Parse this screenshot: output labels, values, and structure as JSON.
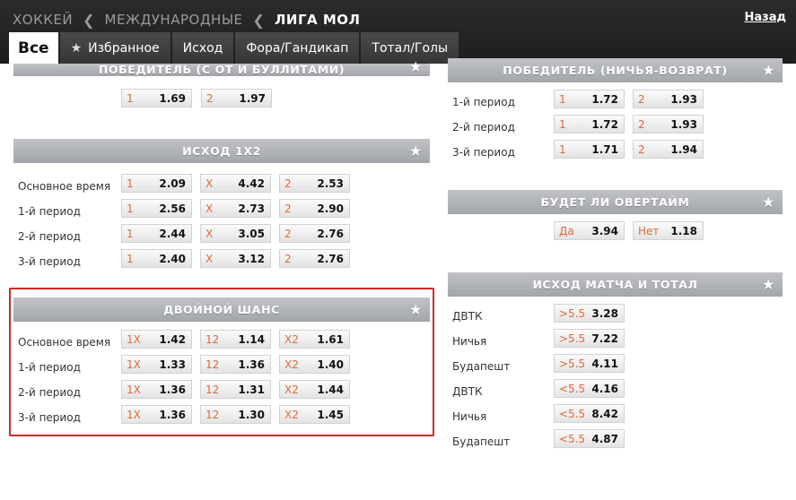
{
  "breadcrumb": [
    "ХОККЕЙ",
    "МЕЖДУНАРОДНЫЕ",
    "ЛИГА МОЛ"
  ],
  "back_label": "Назад",
  "tabs": [
    {
      "label": "Все",
      "active": true
    },
    {
      "label": "Избранное",
      "icon": "star-icon"
    },
    {
      "label": "Исход"
    },
    {
      "label": "Фора/Гандикап"
    },
    {
      "label": "Тотал/Голы"
    }
  ],
  "markets": {
    "winner_ot": {
      "title": "ПОБЕДИТЕЛЬ (С ОТ И БУЛЛИТАМИ)",
      "rows": [
        {
          "label": "",
          "odds": [
            {
              "k": "1",
              "v": "1.69"
            },
            {
              "k": "2",
              "v": "1.97"
            }
          ]
        }
      ]
    },
    "result_1x2": {
      "title": "ИСХОД 1Х2",
      "rows": [
        {
          "label": "Основное время",
          "odds": [
            {
              "k": "1",
              "v": "2.09"
            },
            {
              "k": "X",
              "v": "4.42"
            },
            {
              "k": "2",
              "v": "2.53"
            }
          ]
        },
        {
          "label": "1-й период",
          "odds": [
            {
              "k": "1",
              "v": "2.56"
            },
            {
              "k": "X",
              "v": "2.73"
            },
            {
              "k": "2",
              "v": "2.90"
            }
          ]
        },
        {
          "label": "2-й период",
          "odds": [
            {
              "k": "1",
              "v": "2.44"
            },
            {
              "k": "X",
              "v": "3.05"
            },
            {
              "k": "2",
              "v": "2.76"
            }
          ]
        },
        {
          "label": "3-й период",
          "odds": [
            {
              "k": "1",
              "v": "2.40"
            },
            {
              "k": "X",
              "v": "3.12"
            },
            {
              "k": "2",
              "v": "2.76"
            }
          ]
        }
      ]
    },
    "double_chance": {
      "title": "ДВОЙНОЙ ШАНС",
      "rows": [
        {
          "label": "Основное время",
          "odds": [
            {
              "k": "1X",
              "v": "1.42"
            },
            {
              "k": "12",
              "v": "1.14"
            },
            {
              "k": "X2",
              "v": "1.61"
            }
          ]
        },
        {
          "label": "1-й период",
          "odds": [
            {
              "k": "1X",
              "v": "1.33"
            },
            {
              "k": "12",
              "v": "1.36"
            },
            {
              "k": "X2",
              "v": "1.40"
            }
          ]
        },
        {
          "label": "2-й период",
          "odds": [
            {
              "k": "1X",
              "v": "1.36"
            },
            {
              "k": "12",
              "v": "1.31"
            },
            {
              "k": "X2",
              "v": "1.44"
            }
          ]
        },
        {
          "label": "3-й период",
          "odds": [
            {
              "k": "1X",
              "v": "1.36"
            },
            {
              "k": "12",
              "v": "1.30"
            },
            {
              "k": "X2",
              "v": "1.45"
            }
          ]
        }
      ]
    },
    "winner_dnb": {
      "title": "ПОБЕДИТЕЛЬ (НИЧЬЯ-ВОЗВРАТ)",
      "rows": [
        {
          "label": "1-й период",
          "odds": [
            {
              "k": "1",
              "v": "1.72"
            },
            {
              "k": "2",
              "v": "1.93"
            }
          ]
        },
        {
          "label": "2-й период",
          "odds": [
            {
              "k": "1",
              "v": "1.72"
            },
            {
              "k": "2",
              "v": "1.93"
            }
          ]
        },
        {
          "label": "3-й период",
          "odds": [
            {
              "k": "1",
              "v": "1.71"
            },
            {
              "k": "2",
              "v": "1.94"
            }
          ]
        }
      ]
    },
    "overtime": {
      "title": "БУДЕТ ЛИ ОВЕРТАЙМ",
      "rows": [
        {
          "label": "",
          "odds": [
            {
              "k": "Да",
              "v": "3.94"
            },
            {
              "k": "Нет",
              "v": "1.18"
            }
          ]
        }
      ]
    },
    "result_total": {
      "title": "ИСХОД МАТЧА И ТОТАЛ",
      "rows": [
        {
          "label": "ДВТК",
          "odds": [
            {
              "k": ">5.5",
              "v": "3.28"
            }
          ]
        },
        {
          "label": "Ничья",
          "odds": [
            {
              "k": ">5.5",
              "v": "7.22"
            }
          ]
        },
        {
          "label": "Будапешт",
          "odds": [
            {
              "k": ">5.5",
              "v": "4.11"
            }
          ]
        },
        {
          "label": "ДВТК",
          "odds": [
            {
              "k": "<5.5",
              "v": "4.16"
            }
          ]
        },
        {
          "label": "Ничья",
          "odds": [
            {
              "k": "<5.5",
              "v": "8.42"
            }
          ]
        },
        {
          "label": "Будапешт",
          "odds": [
            {
              "k": "<5.5",
              "v": "4.87"
            }
          ]
        }
      ]
    }
  },
  "colors": {
    "accent": "#e0693a",
    "highlight": "#cc2a2a"
  }
}
